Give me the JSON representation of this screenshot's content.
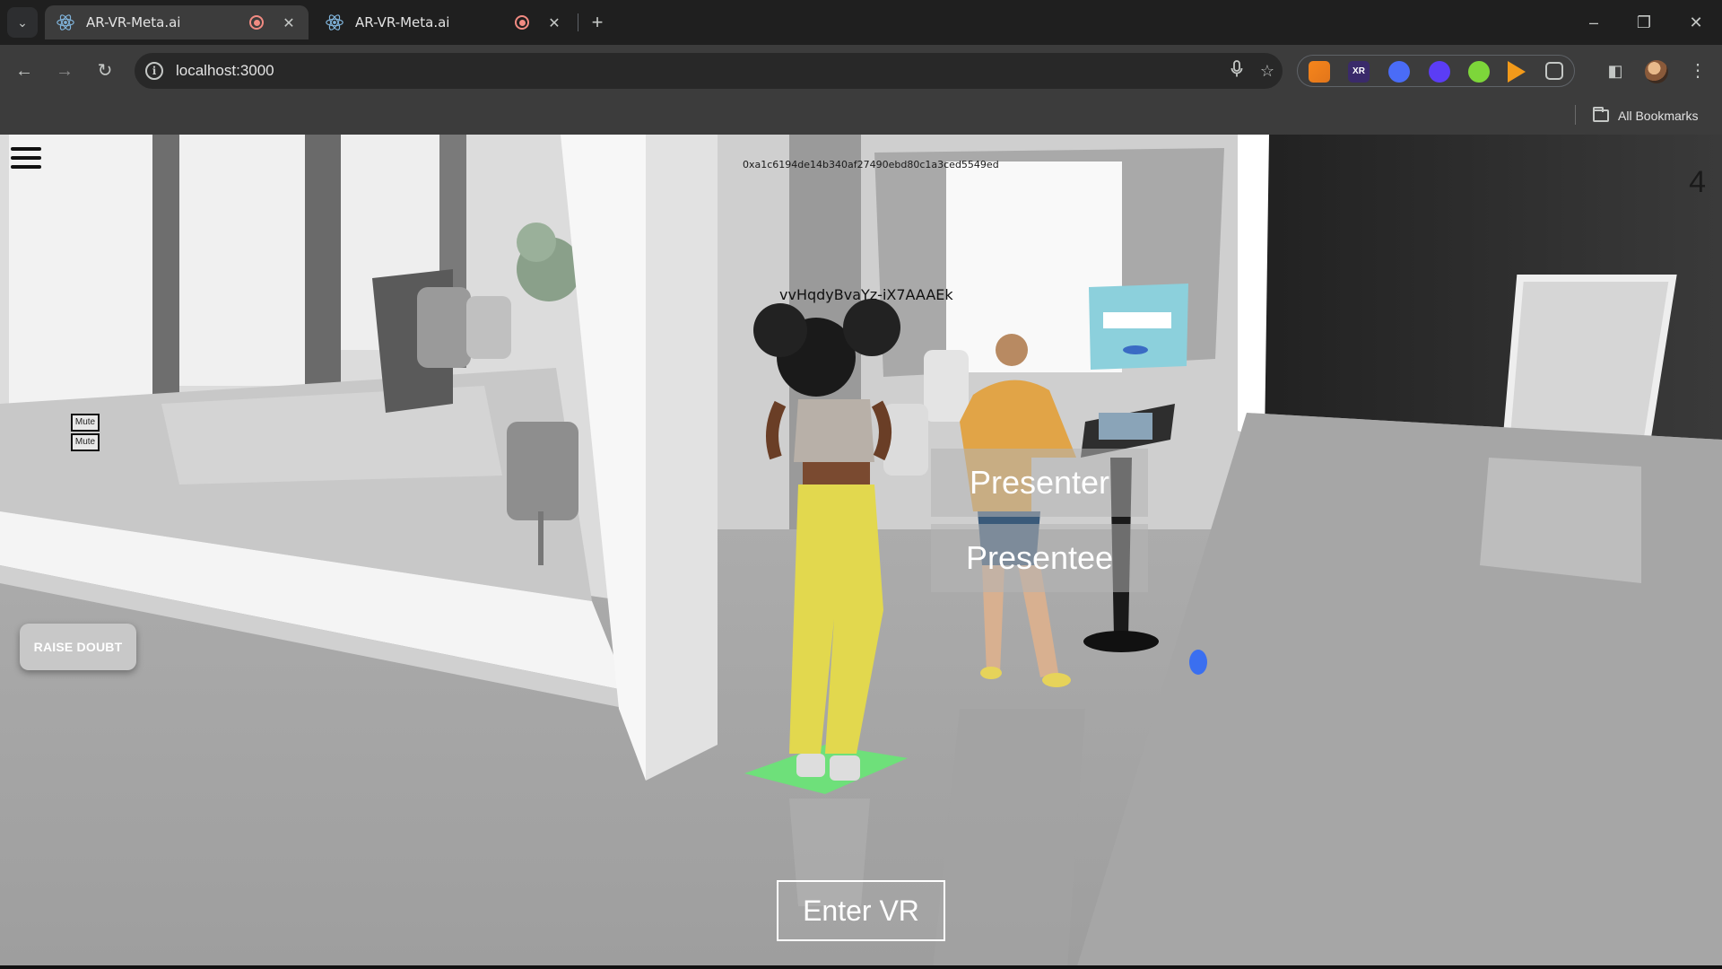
{
  "browser": {
    "tabs": [
      {
        "title": "AR-VR-Meta.ai",
        "active": true
      },
      {
        "title": "AR-VR-Meta.ai",
        "active": false
      }
    ],
    "new_tab_icon": "plus-icon",
    "url": "localhost:3000",
    "bookmarks_bar": {
      "all_bookmarks_label": "All Bookmarks"
    },
    "colors": {
      "tabbar": "#1f1f1f",
      "toolbar": "#3c3c3c",
      "recording": "#f28b82"
    }
  },
  "scene": {
    "wallet_address": "0xa1c6194de14b340af27490ebd80c1a3ced5549ed",
    "peer_id": "vvHqdyBvaYz-iX7AAAEk",
    "user_count": "4",
    "mute_buttons": [
      "Mute",
      "Mute"
    ],
    "raise_doubt_label": "RAISE DOUBT",
    "role_buttons": {
      "presenter": "Presenter",
      "presentee": "Presentee"
    },
    "enter_vr_label": "Enter VR"
  }
}
